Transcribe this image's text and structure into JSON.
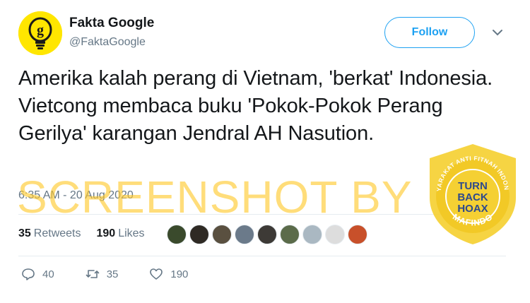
{
  "account": {
    "display_name": "Fakta Google",
    "handle": "@FaktaGoogle",
    "avatar_icon": "lightbulb-g-logo-icon",
    "avatar_color": "#ffe600"
  },
  "follow_button": {
    "label": "Follow",
    "color": "#1da1f2"
  },
  "tweet": {
    "text": "Amerika kalah perang di Vietnam, 'berkat' Indonesia. Vietcong membaca buku 'Pokok-Pokok Perang Gerilya' karangan Jendral AH Nasution.",
    "timestamp": "6:35 AM - 20 Aug 2020"
  },
  "stats": {
    "retweets_count": "35",
    "retweets_label": "Retweets",
    "likes_count": "190",
    "likes_label": "Likes"
  },
  "likers": [
    {
      "icon": "liker-avatar-icon",
      "color": "#3a4a2c"
    },
    {
      "icon": "liker-avatar-icon",
      "color": "#2f2a24"
    },
    {
      "icon": "liker-avatar-icon",
      "color": "#5a5040"
    },
    {
      "icon": "liker-avatar-icon",
      "color": "#6b7a8a"
    },
    {
      "icon": "liker-avatar-icon",
      "color": "#3d3a36"
    },
    {
      "icon": "liker-avatar-icon",
      "color": "#5b6b4a"
    },
    {
      "icon": "liker-avatar-icon",
      "color": "#aab8c2"
    },
    {
      "icon": "liker-avatar-icon",
      "color": "#dddddd"
    },
    {
      "icon": "liker-avatar-icon",
      "color": "#c8502a"
    }
  ],
  "actions": {
    "reply_count": "40",
    "retweet_count": "35",
    "like_count": "190"
  },
  "watermark": {
    "text": "SCREENSHOT BY",
    "badge_lines": [
      "TURN",
      "BACK",
      "HOAX"
    ],
    "badge_ring_top": "MASYARAKAT ANTI FITNAH INDONESIA",
    "badge_ring_bottom": "MAFINDO",
    "badge_color": "#f5d033",
    "badge_text_color": "#2e4a8c"
  }
}
